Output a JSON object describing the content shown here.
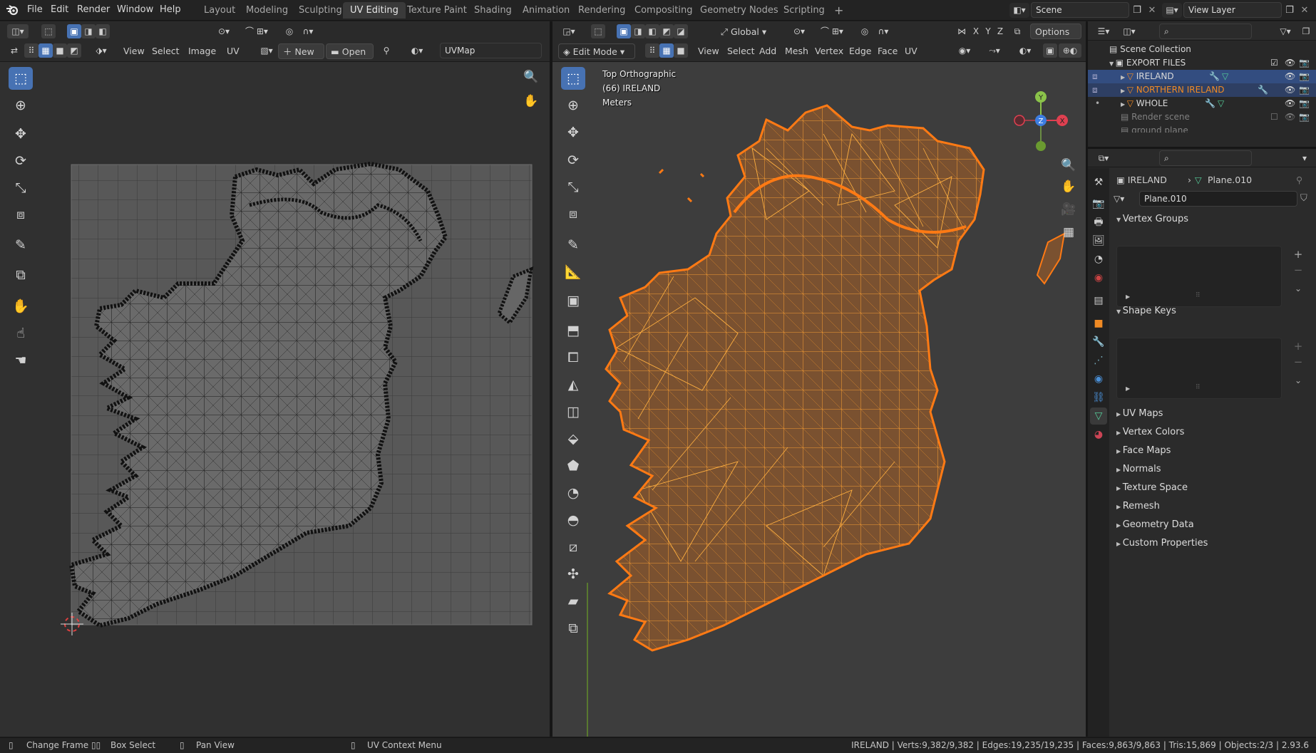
{
  "app": {
    "menu": [
      "File",
      "Edit",
      "Render",
      "Window",
      "Help"
    ],
    "workspaces": [
      "Layout",
      "Modeling",
      "Sculpting",
      "UV Editing",
      "Texture Paint",
      "Shading",
      "Animation",
      "Rendering",
      "Compositing",
      "Geometry Nodes",
      "Scripting"
    ],
    "active_workspace": "UV Editing",
    "add_workspace": "+",
    "scene": "Scene",
    "view_layer": "View Layer"
  },
  "uv_editor": {
    "menus": [
      "View",
      "Select",
      "Image",
      "UV"
    ],
    "new_label": "New",
    "open_label": "Open",
    "uvmap": "UVMap"
  },
  "viewport": {
    "mode": "Edit Mode",
    "transform_orientation": "Global",
    "menus": [
      "View",
      "Select",
      "Add",
      "Mesh",
      "Vertex",
      "Edge",
      "Face",
      "UV"
    ],
    "options_label": "Options",
    "axes": [
      "X",
      "Y",
      "Z"
    ],
    "overlay_lines": [
      "Top Orthographic",
      "(66) IRELAND",
      "Meters"
    ],
    "gizmo": {
      "x": "X",
      "y": "Y",
      "z": "Z"
    }
  },
  "outliner": {
    "root": "Scene Collection",
    "collection": "EXPORT FILES",
    "objects": [
      "IRELAND",
      "NORTHERN IRELAND",
      "WHOLE"
    ],
    "extra": [
      "Render scene",
      "ground plane"
    ]
  },
  "properties": {
    "object": "IRELAND",
    "mesh": "Plane.010",
    "mesh_field": "Plane.010",
    "open_sections": [
      "Vertex Groups",
      "Shape Keys"
    ],
    "collapsed_sections": [
      "UV Maps",
      "Vertex Colors",
      "Face Maps",
      "Normals",
      "Texture Space",
      "Remesh",
      "Geometry Data",
      "Custom Properties"
    ]
  },
  "status": {
    "hints": [
      "Change Frame",
      "Box Select",
      "Pan View",
      "UV Context Menu"
    ],
    "stats": "IRELAND | Verts:9,382/9,382 | Edges:19,235/19,235 | Faces:9,863/9,863 | Tris:15,869 | Objects:2/3 | 2.93.6"
  },
  "colors": {
    "accent": "#4772b3",
    "mesh_fill": "#7a5130",
    "mesh_wire": "#ff9a1f",
    "selected_orange": "#f08a24"
  }
}
